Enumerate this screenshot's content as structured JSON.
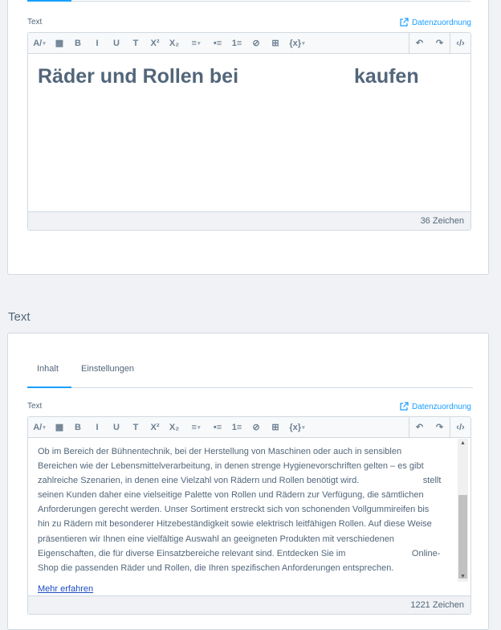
{
  "title_card": {
    "field_label": "Text",
    "mapping_label": "Datenzuordnung",
    "heading_part1": "Räder und Rollen bei",
    "heading_part2": "kaufen",
    "char_count": "36 Zeichen"
  },
  "text_section": {
    "title": "Text",
    "tabs": [
      {
        "label": "Inhalt",
        "active": true
      },
      {
        "label": "Einstellungen",
        "active": false
      }
    ],
    "field_label": "Text",
    "mapping_label": "Datenzuordnung",
    "lines": [
      "Ob im Bereich der Bühnentechnik, bei der Herstellung von Maschinen oder auch in sensiblen",
      "Bereichen wie der Lebensmittelverarbeitung, in denen strenge Hygienevorschriften gelten – es gibt",
      "zahlreiche Szenarien, in denen eine Vielzahl von Rädern und Rollen benötigt wird.                          stellt",
      "seinen Kunden daher eine vielseitige Palette von Rollen und Rädern zur Verfügung, die sämtlichen",
      "Anforderungen gerecht werden. Unser Sortiment erstreckt sich von schonenden Vollgummireifen bis",
      "hin zu Rädern mit besonderer Hitzebeständigkeit sowie elektrisch leitfähigen Rollen. Auf diese Weise",
      "präsentieren wir Ihnen eine vielfältige Auswahl an geeigneten Produkten mit verschiedenen",
      "Eigenschaften, die für diverse Einsatzbereiche relevant sind. Entdecken Sie im                           Online-",
      "Shop die passenden Räder und Rollen, die Ihren spezifischen Anforderungen entsprechen."
    ],
    "more_link": "Mehr erfahren",
    "char_count": "1221 Zeichen"
  },
  "toolbar": {
    "left": [
      {
        "icon": "text-style-icon",
        "glyph": "A/",
        "caret": true
      },
      {
        "icon": "background-color-icon",
        "glyph": "▩"
      },
      {
        "icon": "bold-icon",
        "glyph": "B"
      },
      {
        "icon": "italic-icon",
        "glyph": "I"
      },
      {
        "icon": "underline-icon",
        "glyph": "U"
      },
      {
        "icon": "strikethrough-icon",
        "glyph": "T"
      },
      {
        "icon": "superscript-icon",
        "glyph": "X²"
      },
      {
        "icon": "subscript-icon",
        "glyph": "X₂"
      },
      {
        "icon": "align-icon",
        "glyph": "≡",
        "caret": true
      },
      {
        "icon": "unordered-list-icon",
        "glyph": "•≡"
      },
      {
        "icon": "ordered-list-icon",
        "glyph": "1≡"
      },
      {
        "icon": "link-icon",
        "glyph": "⊘"
      },
      {
        "icon": "table-icon",
        "glyph": "⊞"
      },
      {
        "icon": "code-snippet-icon",
        "glyph": "{x}",
        "caret": true
      }
    ],
    "right": [
      {
        "icon": "undo-icon",
        "glyph": "↶"
      },
      {
        "icon": "redo-icon",
        "glyph": "↷"
      },
      {
        "icon": "code-view-icon",
        "glyph": "‹/›"
      }
    ]
  },
  "colors": {
    "accent": "#189eff",
    "text": "#52667a",
    "link": "#1d4bc4",
    "border": "#d1d9e0"
  }
}
